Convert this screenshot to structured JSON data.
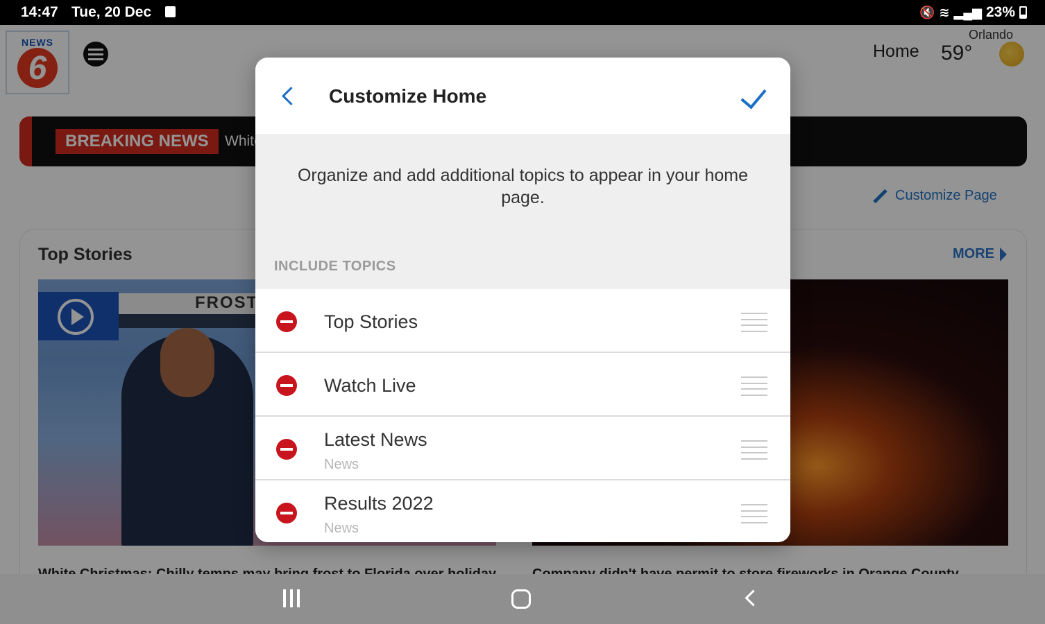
{
  "status_bar": {
    "time": "14:47",
    "date": "Tue, 20 Dec",
    "battery": "23%"
  },
  "app": {
    "logo_text": "NEWS",
    "logo_number": "6",
    "nav_home": "Home",
    "weather": {
      "city": "Orlando",
      "temp": "59°"
    },
    "breaking": {
      "tag": "BREAKING NEWS",
      "text": "White"
    },
    "customize_page": "Customize Page",
    "top_stories": {
      "title": "Top Stories",
      "more": "MORE",
      "thumb1_banner": "FROST",
      "captions": [
        "White Christmas: Chilly temps may bring frost to Florida over holiday",
        "Company didn't have permit to store fireworks in Orange County"
      ]
    }
  },
  "modal": {
    "title": "Customize Home",
    "description": "Organize and add additional topics to appear in your home page.",
    "section_label": "INCLUDE TOPICS",
    "topics": [
      {
        "name": "Top Stories",
        "sub": ""
      },
      {
        "name": "Watch Live",
        "sub": ""
      },
      {
        "name": "Latest News",
        "sub": "News"
      },
      {
        "name": "Results 2022",
        "sub": "News"
      }
    ]
  },
  "colors": {
    "accent": "#1a6fc4",
    "remove": "#c8141c",
    "breaking": "#d22b1e"
  }
}
